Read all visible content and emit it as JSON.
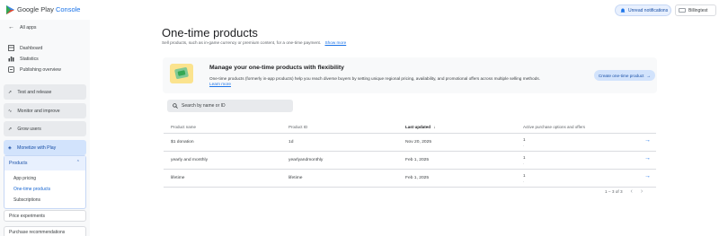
{
  "app": {
    "brand_main": "Google Play",
    "brand_accent": "Console"
  },
  "header": {
    "notifications_label": "Unread notifications",
    "account_label": "Billingtest"
  },
  "sidebar": {
    "back_label": "All apps",
    "items": [
      {
        "label": "Dashboard",
        "icon": "dashboard-icon"
      },
      {
        "label": "Statistics",
        "icon": "bar-chart-icon"
      },
      {
        "label": "Publishing overview",
        "icon": "publish-icon"
      }
    ],
    "sections": [
      {
        "label": "Test and release",
        "icon": "rocket-icon"
      },
      {
        "label": "Monitor and improve",
        "icon": "pulse-icon"
      },
      {
        "label": "Grow users",
        "icon": "growth-icon"
      },
      {
        "label": "Monetize with Play",
        "icon": "tag-icon"
      }
    ],
    "products": {
      "label": "Products",
      "subitems": [
        "App pricing",
        "One-time products",
        "Subscriptions"
      ],
      "selected": "One-time products"
    },
    "extra": [
      "Price experiments",
      "Purchase recommendations"
    ]
  },
  "main": {
    "title": "One-time products",
    "subtitle": "Sell products, such as in-game currency or premium content, for a one-time payment.",
    "subtitle_link": "Show more"
  },
  "card": {
    "title": "Manage your one-time products with flexibility",
    "body": "One-time products (formerly in-app products) help you reach diverse buyers by setting unique regional pricing, availability, and promotional offers across multiple selling methods.",
    "link": "Learn more",
    "create_button": "Create one-time product"
  },
  "search": {
    "placeholder": "Search by name or ID"
  },
  "table": {
    "columns": [
      "Product name",
      "Product ID",
      "Last updated",
      "Active purchase options and offers"
    ],
    "sort_indicator": "↓",
    "rows": [
      {
        "name": "$1 donation",
        "id": "1d",
        "updated": "Nov 20, 2025",
        "options": "1",
        "offers": "-"
      },
      {
        "name": "yearly and monthly",
        "id": "yearlyandmonthly",
        "updated": "Feb 1, 2025",
        "options": "1",
        "offers": "-"
      },
      {
        "name": "lifetime",
        "id": "lifetime",
        "updated": "Feb 1, 2025",
        "options": "1",
        "offers": "-"
      }
    ],
    "pagination": "1 – 3 of 3"
  },
  "colors": {
    "accent": "#1a73e8",
    "sidebar_active": "#d2e3fc",
    "section_bg": "#e8eaed"
  }
}
